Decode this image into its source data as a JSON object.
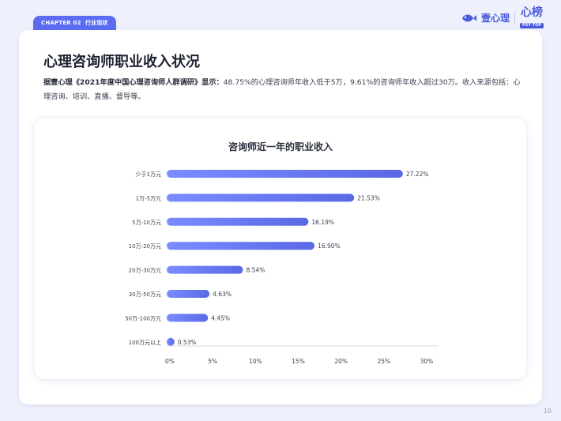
{
  "header": {
    "chapter": "CHAPTER 02",
    "chapter_section": "行业现状",
    "brand_name": "壹心理",
    "brand_mark": "心榜",
    "brand_mark_sub": "PSY TOP"
  },
  "page": {
    "title": "心理咨询师职业收入状况",
    "summary_lead": "据壹心理《2021年度中国心理咨询师人群调研》显示：",
    "summary_rest": "48.75%的心理咨询师年收入低于5万，9.61%的咨询师年收入超过30万。收入来源包括：心理咨询、培训、直播、督导等。",
    "page_number": "10"
  },
  "colors": {
    "accent": "#5b6cf3",
    "bar_start": "#7b8cff",
    "bar_end": "#5a68e6",
    "background": "#eef1fb"
  },
  "chart_data": {
    "type": "bar",
    "orientation": "horizontal",
    "title": "咨询师近一年的职业收入",
    "categories": [
      "少于1万元",
      "1万-5万元",
      "5万-10万元",
      "10万-20万元",
      "20万-30万元",
      "30万-50万元",
      "50万-100万元",
      "100万元以上"
    ],
    "values": [
      27.22,
      21.53,
      16.19,
      16.9,
      8.54,
      4.63,
      4.45,
      0.53
    ],
    "value_labels": [
      "27.22%",
      "21.53%",
      "16.19%",
      "16.90%",
      "8.54%",
      "4.63%",
      "4.45%",
      "0.53%"
    ],
    "xlim": [
      0,
      30
    ],
    "xticks": [
      0,
      5,
      10,
      15,
      20,
      25,
      30
    ],
    "xtick_labels": [
      "0%",
      "5%",
      "10%",
      "15%",
      "20%",
      "25%",
      "30%"
    ],
    "grid": false,
    "legend": "none"
  }
}
